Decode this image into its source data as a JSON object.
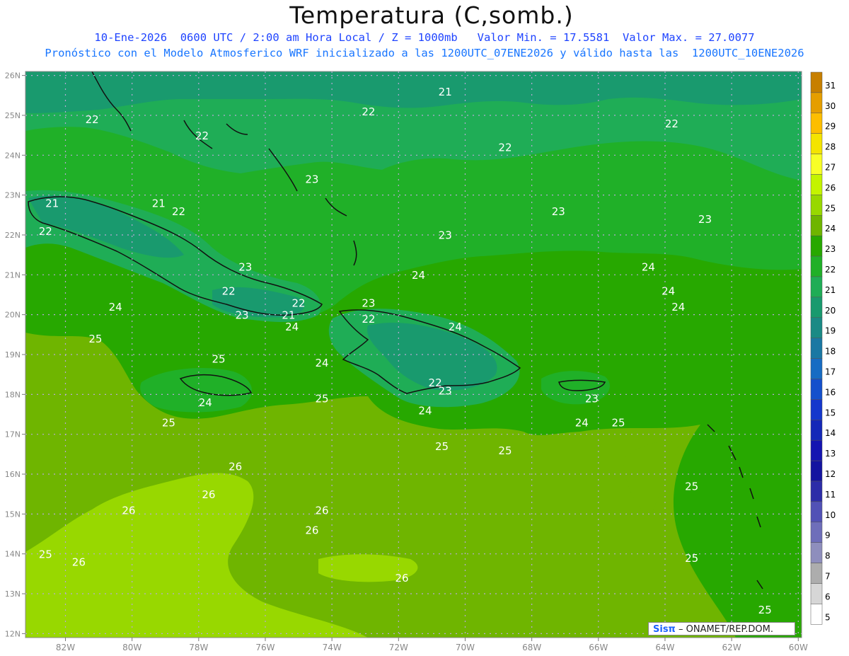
{
  "header": {
    "title": "Temperatura (C,somb.)",
    "line1": "10-Ene-2026  0600 UTC / 2:00 am Hora Local / Z = 1000mb   Valor Min. = 17.5581  Valor Max. = 27.0077",
    "line2": "Pronóstico con el Modelo Atmosferico WRF inicializado a las 1200UTC_07ENE2026 y válido hasta las  1200UTC_10ENE2026"
  },
  "map": {
    "lon_range": [
      -83.2,
      -59.9
    ],
    "lat_range": [
      11.9,
      26.1
    ],
    "lon_ticks": [
      "82W",
      "80W",
      "78W",
      "76W",
      "74W",
      "72W",
      "70W",
      "68W",
      "66W",
      "64W",
      "62W",
      "60W"
    ],
    "lat_ticks": [
      "26N",
      "25N",
      "24N",
      "23N",
      "22N",
      "21N",
      "20N",
      "19N",
      "18N",
      "17N",
      "16N",
      "15N",
      "14N",
      "13N",
      "12N"
    ],
    "grid": "dotted"
  },
  "colorbar": {
    "levels": [
      "31",
      "30",
      "29",
      "28",
      "27",
      "26",
      "25",
      "24",
      "23",
      "22",
      "21",
      "20",
      "19",
      "18",
      "17",
      "16",
      "15",
      "14",
      "13",
      "12",
      "11",
      "10",
      "9",
      "8",
      "7",
      "6",
      "5"
    ],
    "colors": [
      "#c77f00",
      "#e59e00",
      "#fdbe00",
      "#f4e400",
      "#f8ff26",
      "#c4f400",
      "#98d800",
      "#6fb500",
      "#27a800",
      "#20b028",
      "#1fad56",
      "#199a6e",
      "#1a8a85",
      "#1a78a3",
      "#176cc3",
      "#1450cc",
      "#1437cc",
      "#1428b8",
      "#1414b1",
      "#1414a0",
      "#2d2da8",
      "#5151b6",
      "#6e6eba",
      "#8e8ebd",
      "#adadad",
      "#d6d6d6",
      "#ffffff"
    ]
  },
  "contours": {
    "labels": [
      {
        "text": "21",
        "lon": -70.6,
        "lat": 25.5
      },
      {
        "text": "22",
        "lon": -81.2,
        "lat": 24.8
      },
      {
        "text": "22",
        "lon": -77.9,
        "lat": 24.4
      },
      {
        "text": "22",
        "lon": -72.9,
        "lat": 25.0
      },
      {
        "text": "22",
        "lon": -68.8,
        "lat": 24.1
      },
      {
        "text": "22",
        "lon": -63.8,
        "lat": 24.7
      },
      {
        "text": "23",
        "lon": -74.6,
        "lat": 23.3
      },
      {
        "text": "23",
        "lon": -67.2,
        "lat": 22.5
      },
      {
        "text": "23",
        "lon": -62.8,
        "lat": 22.3
      },
      {
        "text": "21",
        "lon": -82.4,
        "lat": 22.7
      },
      {
        "text": "21",
        "lon": -79.2,
        "lat": 22.7
      },
      {
        "text": "22",
        "lon": -78.6,
        "lat": 22.5
      },
      {
        "text": "22",
        "lon": -82.6,
        "lat": 22.0
      },
      {
        "text": "23",
        "lon": -76.6,
        "lat": 21.1
      },
      {
        "text": "23",
        "lon": -70.6,
        "lat": 21.9
      },
      {
        "text": "24",
        "lon": -71.4,
        "lat": 20.9
      },
      {
        "text": "22",
        "lon": -77.1,
        "lat": 20.5
      },
      {
        "text": "24",
        "lon": -80.5,
        "lat": 20.1
      },
      {
        "text": "22",
        "lon": -75.0,
        "lat": 20.2
      },
      {
        "text": "21",
        "lon": -75.3,
        "lat": 19.9
      },
      {
        "text": "23",
        "lon": -76.7,
        "lat": 19.9
      },
      {
        "text": "24",
        "lon": -75.2,
        "lat": 19.6
      },
      {
        "text": "23",
        "lon": -72.9,
        "lat": 20.2
      },
      {
        "text": "22",
        "lon": -72.9,
        "lat": 19.8
      },
      {
        "text": "24",
        "lon": -70.3,
        "lat": 19.6
      },
      {
        "text": "24",
        "lon": -64.5,
        "lat": 21.1
      },
      {
        "text": "24",
        "lon": -63.9,
        "lat": 20.5
      },
      {
        "text": "24",
        "lon": -63.6,
        "lat": 20.1
      },
      {
        "text": "25",
        "lon": -81.1,
        "lat": 19.3
      },
      {
        "text": "25",
        "lon": -77.4,
        "lat": 18.8
      },
      {
        "text": "24",
        "lon": -74.3,
        "lat": 18.7
      },
      {
        "text": "22",
        "lon": -70.9,
        "lat": 18.2
      },
      {
        "text": "23",
        "lon": -70.6,
        "lat": 18.0
      },
      {
        "text": "24",
        "lon": -77.8,
        "lat": 17.7
      },
      {
        "text": "25",
        "lon": -74.3,
        "lat": 17.8
      },
      {
        "text": "25",
        "lon": -78.9,
        "lat": 17.2
      },
      {
        "text": "23",
        "lon": -66.2,
        "lat": 17.8
      },
      {
        "text": "24",
        "lon": -71.2,
        "lat": 17.5
      },
      {
        "text": "24",
        "lon": -66.5,
        "lat": 17.2
      },
      {
        "text": "25",
        "lon": -65.4,
        "lat": 17.2
      },
      {
        "text": "25",
        "lon": -70.7,
        "lat": 16.6
      },
      {
        "text": "25",
        "lon": -68.8,
        "lat": 16.5
      },
      {
        "text": "26",
        "lon": -76.9,
        "lat": 16.1
      },
      {
        "text": "26",
        "lon": -77.7,
        "lat": 15.4
      },
      {
        "text": "26",
        "lon": -80.1,
        "lat": 15.0
      },
      {
        "text": "26",
        "lon": -74.3,
        "lat": 15.0
      },
      {
        "text": "26",
        "lon": -74.6,
        "lat": 14.5
      },
      {
        "text": "25",
        "lon": -63.2,
        "lat": 15.6
      },
      {
        "text": "25",
        "lon": -82.6,
        "lat": 13.9
      },
      {
        "text": "26",
        "lon": -81.6,
        "lat": 13.7
      },
      {
        "text": "25",
        "lon": -63.2,
        "lat": 13.8
      },
      {
        "text": "26",
        "lon": -71.9,
        "lat": 13.3
      },
      {
        "text": "25",
        "lon": -61.0,
        "lat": 12.5
      }
    ]
  },
  "credit": {
    "sis": "Sisπ",
    "org": " – ONAMET/REP.DOM."
  }
}
